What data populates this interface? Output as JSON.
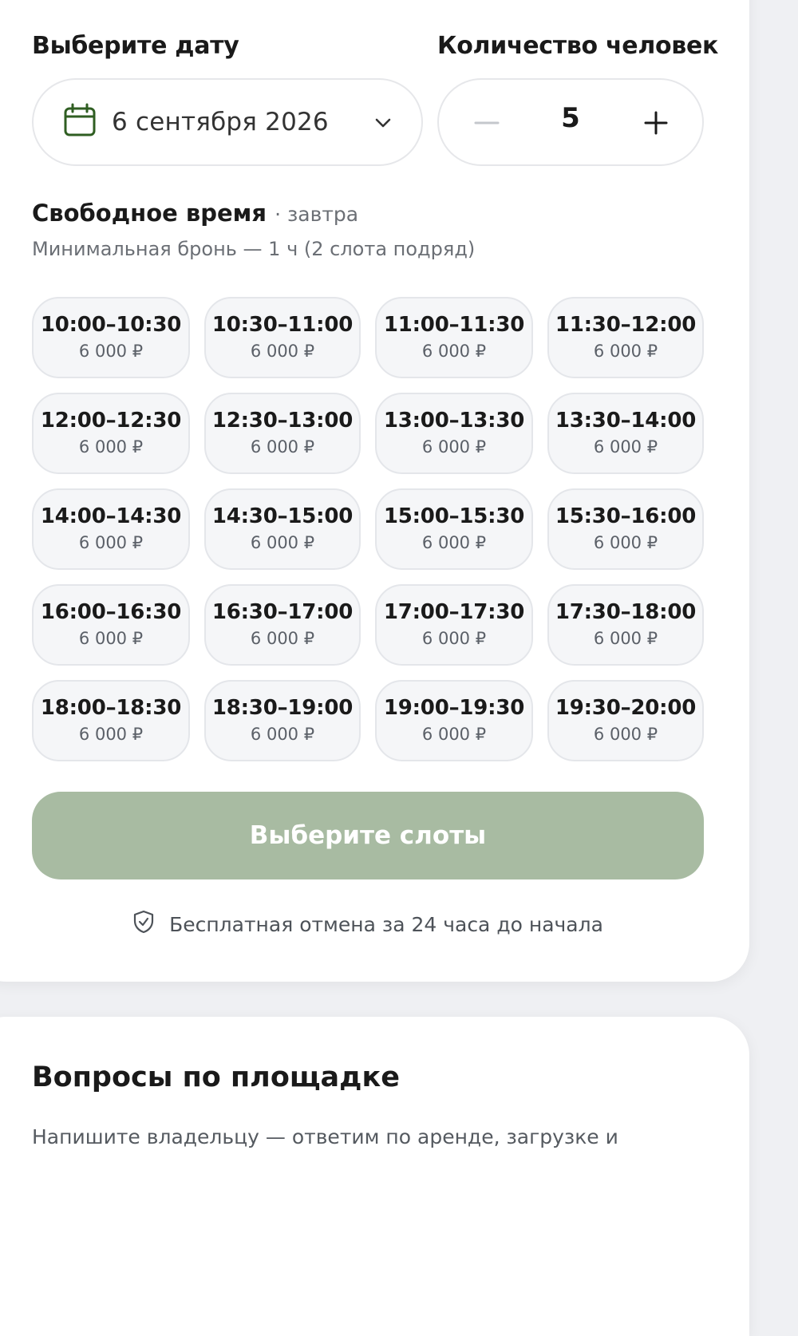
{
  "booking": {
    "date_label": "Выберите дату",
    "people_label": "Количество человек",
    "date_value": "6 сентября 2026",
    "people_count": "5",
    "icons": {
      "calendar": "calendar-icon",
      "chevron": "chevron-down-icon",
      "minus": "minus-icon",
      "plus": "plus-icon"
    }
  },
  "slots_section": {
    "title": "Свободное время",
    "subtitle": "· завтра",
    "note": "Минимальная бронь — 1 ч (2 слота подряд)",
    "slots": [
      {
        "time": "10:00–10:30",
        "price": "6 000 ₽"
      },
      {
        "time": "10:30–11:00",
        "price": "6 000 ₽"
      },
      {
        "time": "11:00–11:30",
        "price": "6 000 ₽"
      },
      {
        "time": "11:30–12:00",
        "price": "6 000 ₽"
      },
      {
        "time": "12:00–12:30",
        "price": "6 000 ₽"
      },
      {
        "time": "12:30–13:00",
        "price": "6 000 ₽"
      },
      {
        "time": "13:00–13:30",
        "price": "6 000 ₽"
      },
      {
        "time": "13:30–14:00",
        "price": "6 000 ₽"
      },
      {
        "time": "14:00–14:30",
        "price": "6 000 ₽"
      },
      {
        "time": "14:30–15:00",
        "price": "6 000 ₽"
      },
      {
        "time": "15:00–15:30",
        "price": "6 000 ₽"
      },
      {
        "time": "15:30–16:00",
        "price": "6 000 ₽"
      },
      {
        "time": "16:00–16:30",
        "price": "6 000 ₽"
      },
      {
        "time": "16:30–17:00",
        "price": "6 000 ₽"
      },
      {
        "time": "17:00–17:30",
        "price": "6 000 ₽"
      },
      {
        "time": "17:30–18:00",
        "price": "6 000 ₽"
      },
      {
        "time": "18:00–18:30",
        "price": "6 000 ₽"
      },
      {
        "time": "18:30–19:00",
        "price": "6 000 ₽"
      },
      {
        "time": "19:00–19:30",
        "price": "6 000 ₽"
      },
      {
        "time": "19:30–20:00",
        "price": "6 000 ₽"
      }
    ]
  },
  "cta": {
    "label": "Выберите слоты"
  },
  "cancellation": {
    "text": "Бесплатная отмена за 24 часа до начала",
    "icon": "shield-check-icon"
  },
  "questions": {
    "title": "Вопросы по площадке",
    "text": "Напишите владельцу — ответим по аренде, загрузке и"
  },
  "colors": {
    "accent_green": "#2f5e22",
    "cta_disabled": "#a8bba2",
    "background": "#eff0f3",
    "slot_bg": "#f5f6f8"
  }
}
